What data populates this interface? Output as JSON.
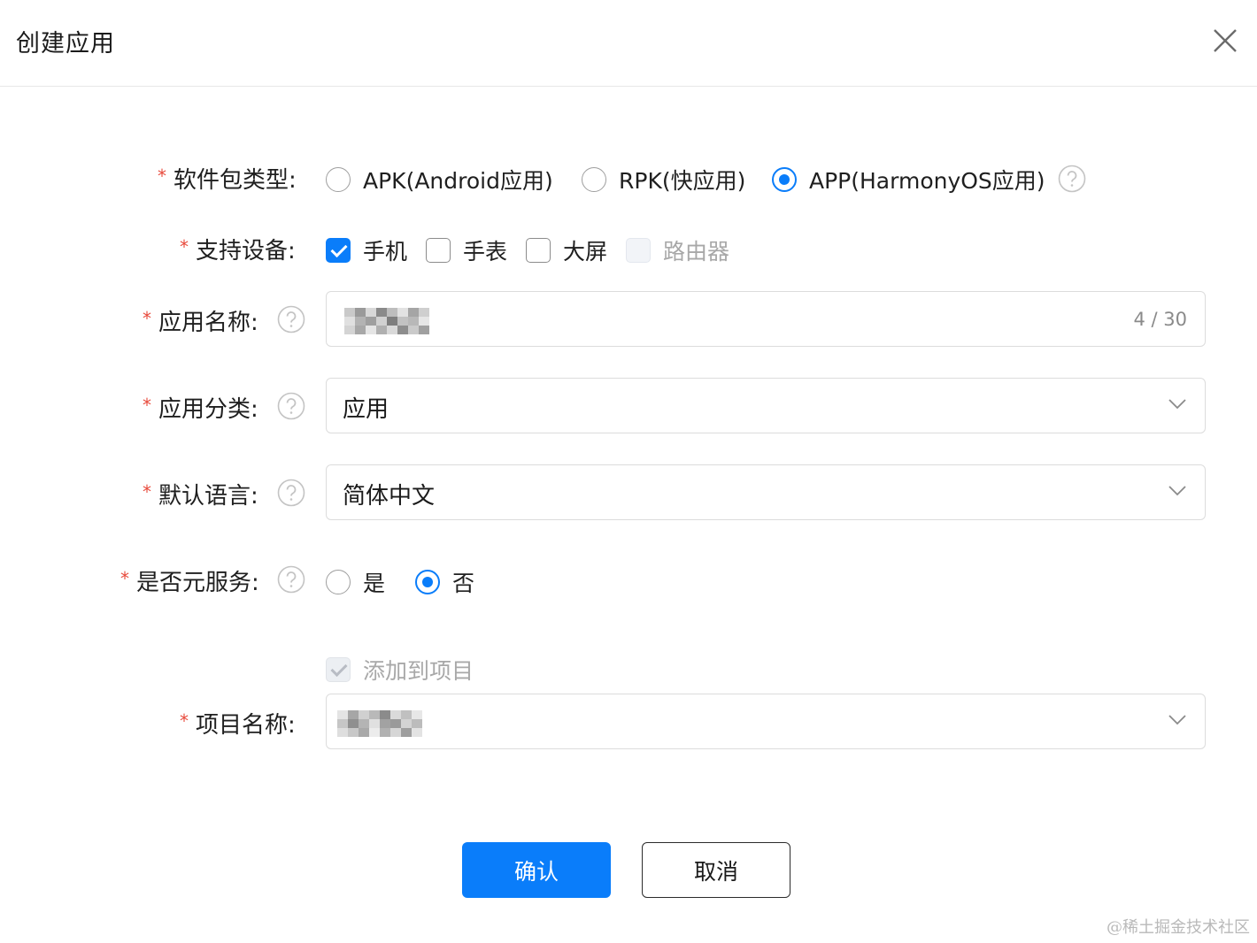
{
  "dialog": {
    "title": "创建应用"
  },
  "form": {
    "package_type": {
      "label": "软件包类型:",
      "options": [
        "APK(Android应用)",
        "RPK(快应用)",
        "APP(HarmonyOS应用)"
      ],
      "selected": "APP(HarmonyOS应用)"
    },
    "devices": {
      "label": "支持设备:",
      "options": [
        "手机",
        "手表",
        "大屏",
        "路由器"
      ],
      "checked": [
        "手机"
      ],
      "disabled": [
        "路由器"
      ]
    },
    "app_name": {
      "label": "应用名称:",
      "value_obscured": true,
      "counter": "4 / 30"
    },
    "app_category": {
      "label": "应用分类:",
      "value": "应用"
    },
    "default_language": {
      "label": "默认语言:",
      "value": "简体中文"
    },
    "atomic_service": {
      "label": "是否元服务:",
      "options": [
        "是",
        "否"
      ],
      "selected": "否"
    },
    "add_to_project": {
      "label": "添加到项目",
      "checked": true,
      "disabled": true
    },
    "project_name": {
      "label": "项目名称:",
      "value_obscured": true
    },
    "required_mark": "*"
  },
  "buttons": {
    "confirm": "确认",
    "cancel": "取消"
  },
  "watermark": "@稀土掘金技术社区",
  "icons": {
    "close": "close-icon",
    "help": "question-circle-icon",
    "dropdown": "chevron-down-icon"
  },
  "colors": {
    "primary": "#0a7dfa",
    "required": "#e84a3c",
    "border": "#dcdcdc"
  }
}
